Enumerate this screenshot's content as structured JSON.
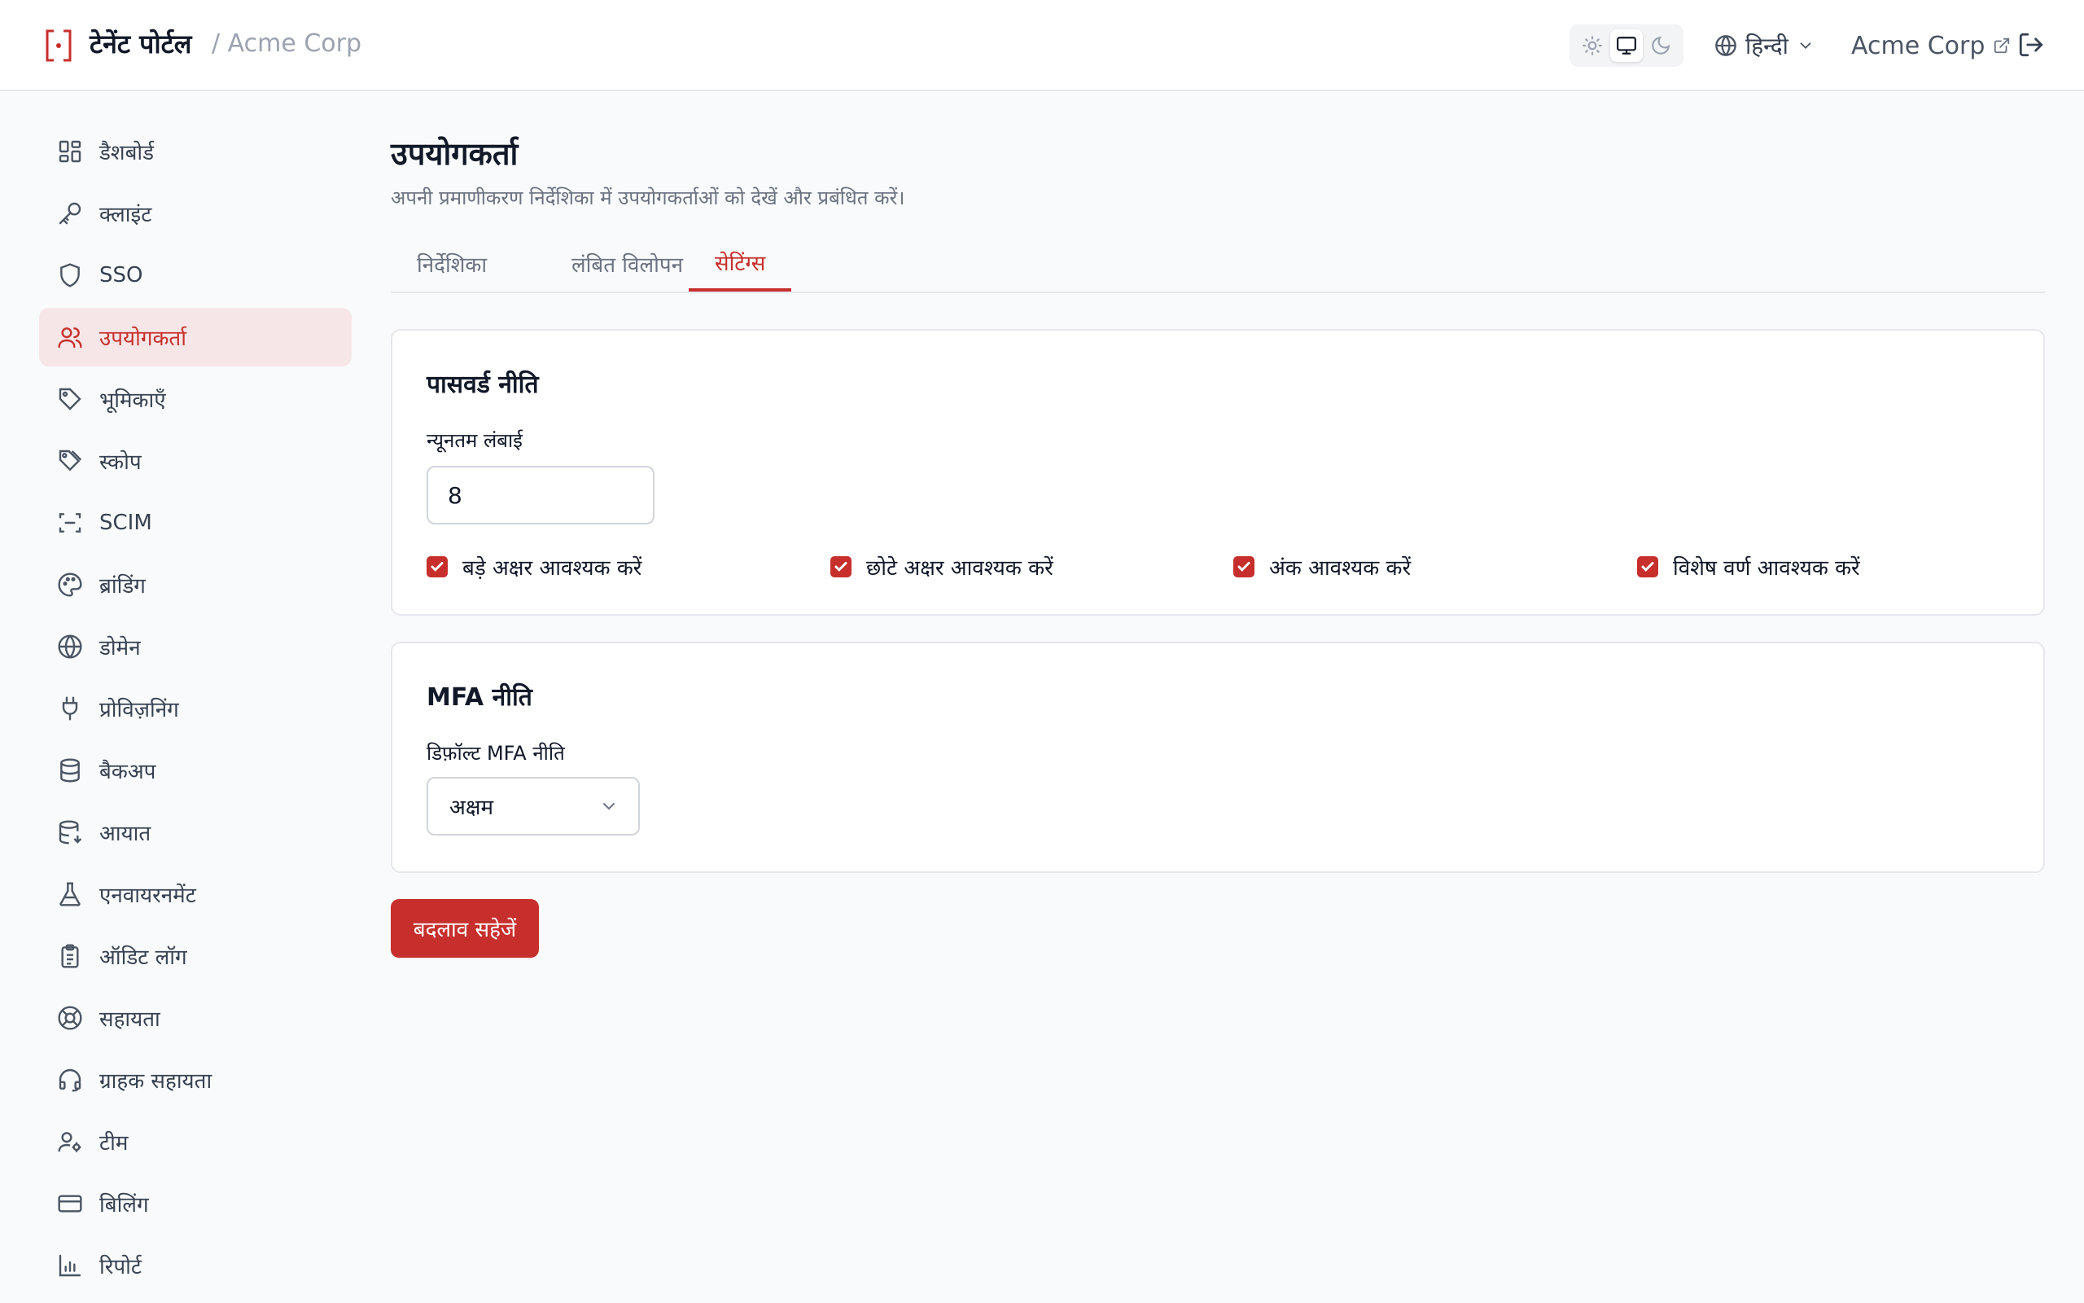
{
  "header": {
    "brand": "टेनेंट पोर्टल",
    "crumb": "/ Acme Corp",
    "theme_icons": [
      "sun-icon",
      "monitor-icon",
      "moon-icon"
    ],
    "theme_selected": "monitor",
    "language": "हिन्दी",
    "org_name": "Acme Corp"
  },
  "sidebar": {
    "items": [
      {
        "label": "डैशबोर्ड",
        "icon": "dashboard-icon"
      },
      {
        "label": "क्लाइंट",
        "icon": "key-icon"
      },
      {
        "label": "SSO",
        "icon": "shield-icon"
      },
      {
        "label": "उपयोगकर्ता",
        "icon": "users-icon",
        "active": true
      },
      {
        "label": "भूमिकाएँ",
        "icon": "tag-icon"
      },
      {
        "label": "स्कोप",
        "icon": "tags-icon"
      },
      {
        "label": "SCIM",
        "icon": "scan-icon"
      },
      {
        "label": "ब्रांडिंग",
        "icon": "palette-icon"
      },
      {
        "label": "डोमेन",
        "icon": "globe-icon"
      },
      {
        "label": "प्रोविज़निंग",
        "icon": "plug-icon"
      },
      {
        "label": "बैकअप",
        "icon": "database-icon"
      },
      {
        "label": "आयात",
        "icon": "database-import-icon"
      },
      {
        "label": "एनवायरनमेंट",
        "icon": "flask-icon"
      },
      {
        "label": "ऑडिट लॉग",
        "icon": "clipboard-icon"
      },
      {
        "label": "सहायता",
        "icon": "lifebuoy-icon"
      },
      {
        "label": "ग्राहक सहायता",
        "icon": "headset-icon"
      },
      {
        "label": "टीम",
        "icon": "user-cog-icon"
      },
      {
        "label": "बिलिंग",
        "icon": "credit-card-icon"
      },
      {
        "label": "रिपोर्ट",
        "icon": "bar-chart-icon"
      }
    ]
  },
  "main": {
    "title": "उपयोगकर्ता",
    "subtitle": "अपनी प्रमाणीकरण निर्देशिका में उपयोगकर्ताओं को देखें और प्रबंधित करें।",
    "tabs": [
      {
        "label": "निर्देशिका"
      },
      {
        "label": "लंबित विलोपन"
      },
      {
        "label": "सेटिंग्स",
        "active": true
      }
    ],
    "password_policy": {
      "title": "पासवर्ड नीति",
      "min_length_label": "न्यूनतम लंबाई",
      "min_length_value": "8",
      "checks": [
        {
          "label": "बड़े अक्षर आवश्यक करें",
          "checked": true
        },
        {
          "label": "छोटे अक्षर आवश्यक करें",
          "checked": true
        },
        {
          "label": "अंक आवश्यक करें",
          "checked": true
        },
        {
          "label": "विशेष वर्ण आवश्यक करें",
          "checked": true
        }
      ]
    },
    "mfa_policy": {
      "title": "MFA नीति",
      "default_label": "डिफ़ॉल्ट MFA नीति",
      "selected": "अक्षम"
    },
    "save_label": "बदलाव सहेजें"
  },
  "colors": {
    "accent": "#c62f2c",
    "active_bg": "#f6e6e7",
    "page_bg": "#f9fafb"
  }
}
